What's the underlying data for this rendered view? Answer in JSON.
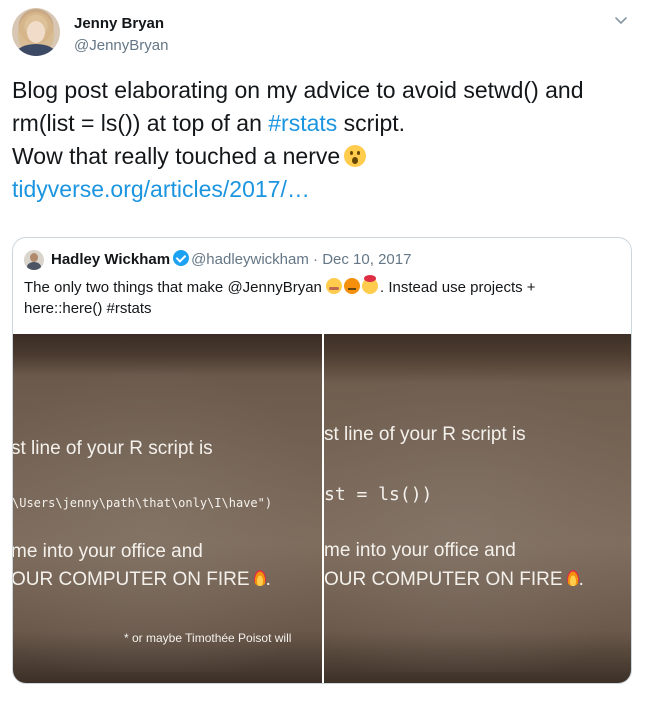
{
  "author": {
    "name": "Jenny Bryan",
    "handle": "@JennyBryan"
  },
  "tweet": {
    "line1": "Blog post elaborating on my advice to avoid setwd() and",
    "line2_pre": "rm(list = ls()) at top of an ",
    "line2_hashtag": "#rstats",
    "line2_post": " script.",
    "line3": "Wow that really touched a nerve",
    "link": "tidyverse.org/articles/2017/…"
  },
  "quoted": {
    "name": "Hadley Wickham",
    "handle": "@hadleywickham",
    "separator": " · ",
    "date": "Dec 10, 2017",
    "text_pre": "The only two things that make @JennyBryan ",
    "text_post": ". Instead use projects +",
    "text_line2": "here::here() #rstats",
    "photo_left": {
      "line1": "st line of your R script is",
      "line2": "\\Users\\jenny\\path\\that\\only\\I\\have\")",
      "line3": "me into your office and",
      "line4": "OUR COMPUTER ON FIRE",
      "line4_post": ".",
      "footnote": "* or maybe Timothée Poisot will"
    },
    "photo_right": {
      "line1": "st line of your R script is",
      "line2": "st = ls())",
      "line3": "me into your office and",
      "line4": "OUR COMPUTER ON FIRE",
      "line4_post": "."
    }
  },
  "icons": {
    "menu": "chevron-down-icon",
    "verified": "verified-badge-icon",
    "emoji_wow": "astonished-face-emoji",
    "emoji_fire": "fire-emoji"
  },
  "colors": {
    "link": "#1b95e0",
    "text": "#14171a",
    "secondary": "#657786",
    "border": "#ccd6dd",
    "verified": "#1da1f2"
  }
}
